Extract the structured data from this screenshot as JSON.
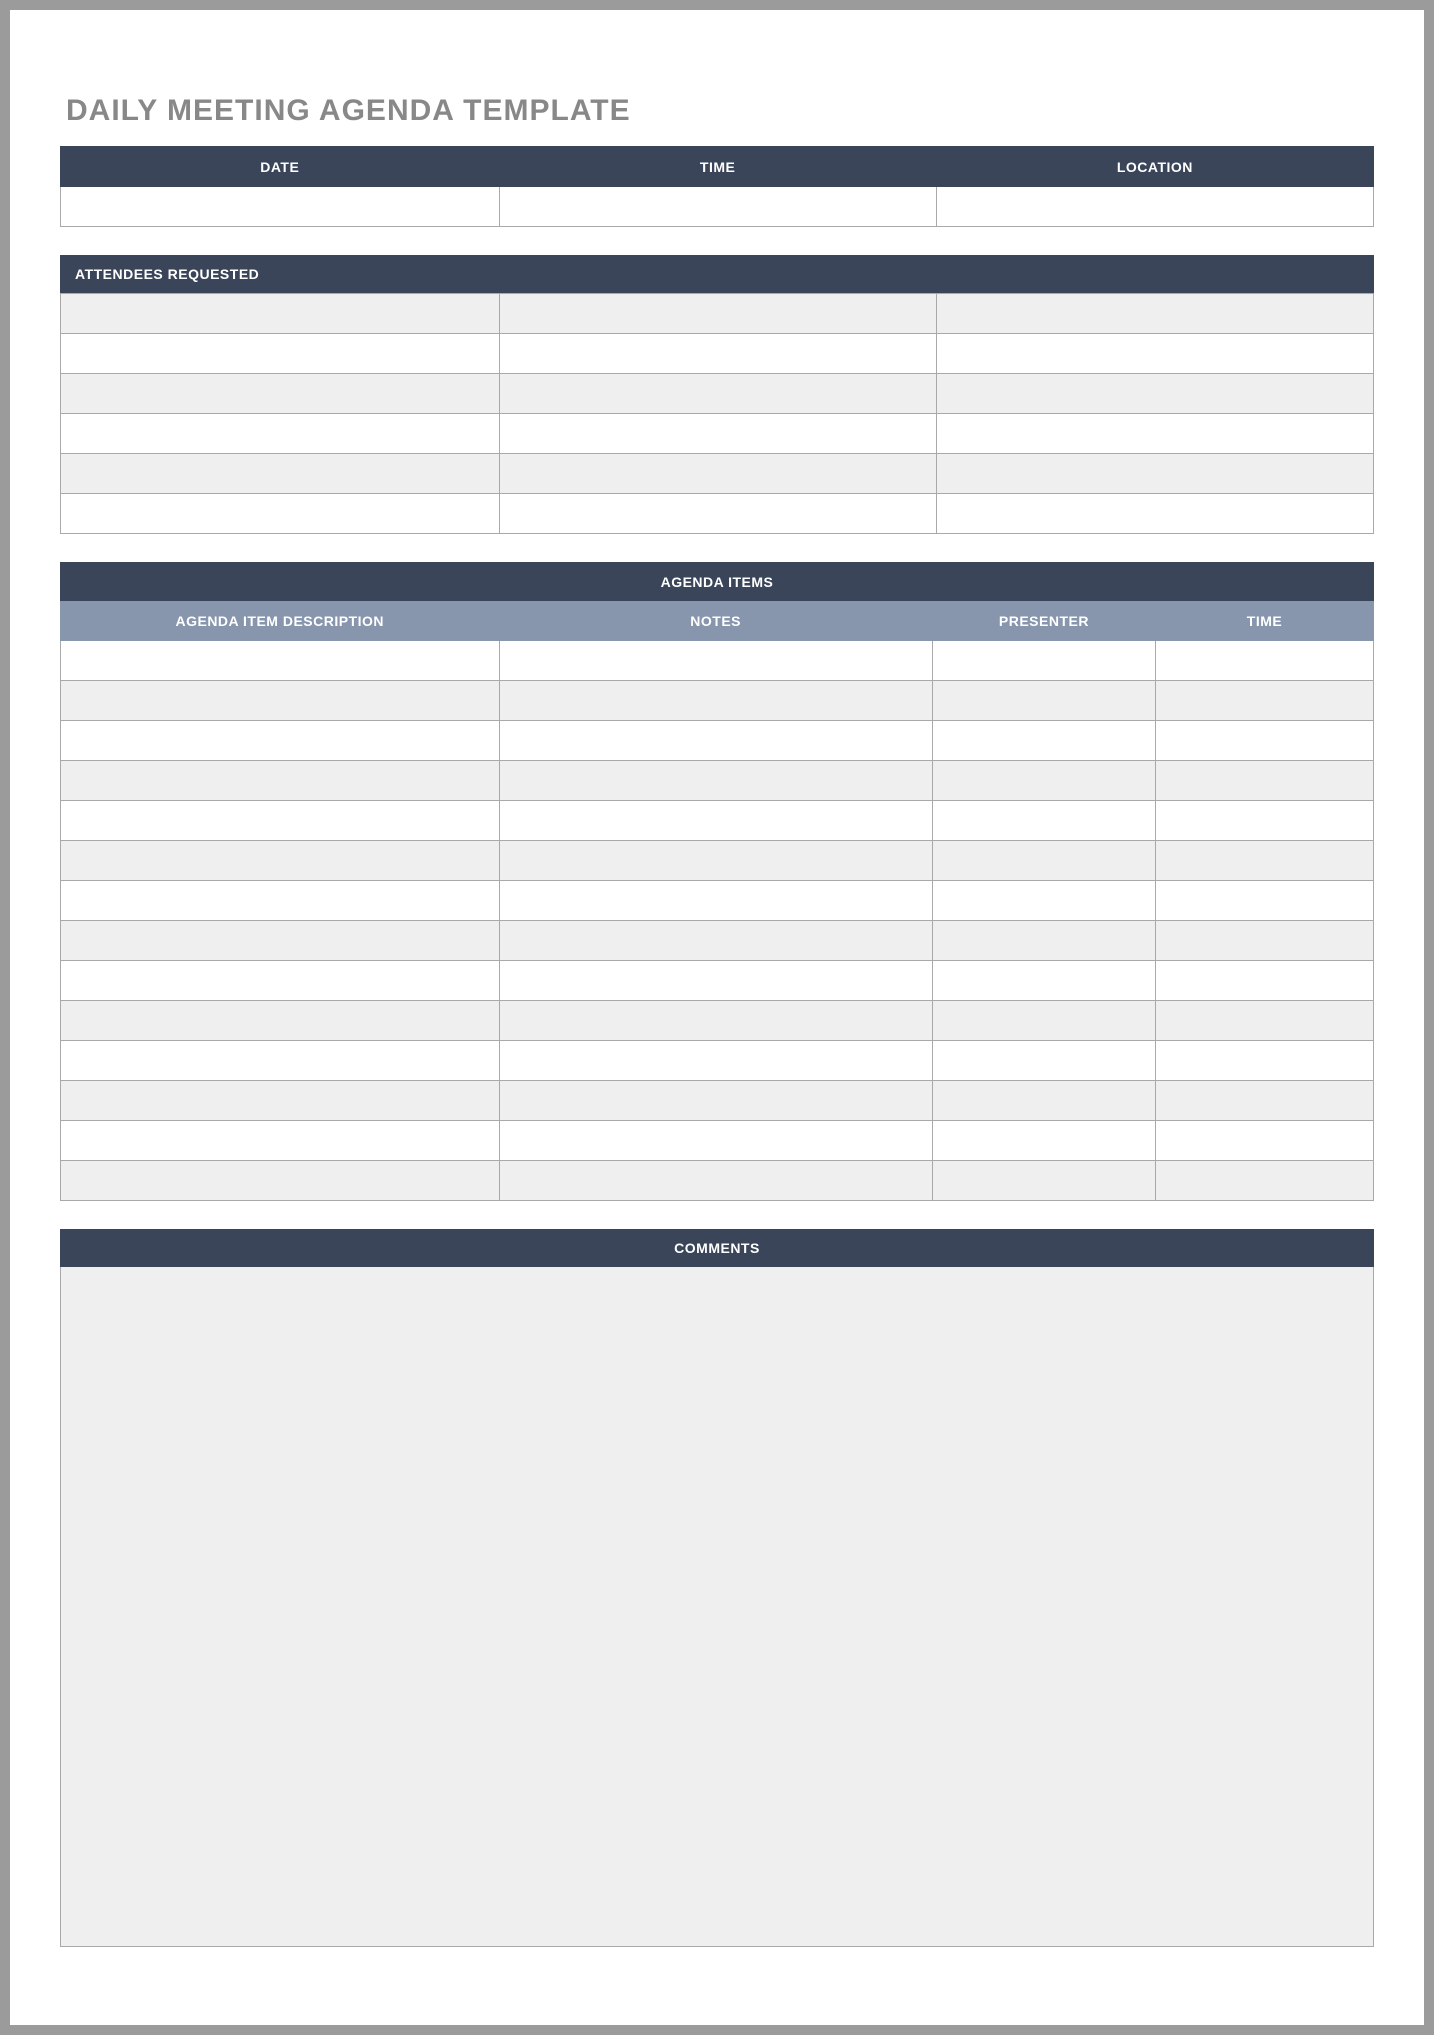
{
  "title": "DAILY MEETING AGENDA TEMPLATE",
  "details": {
    "headers": {
      "date": "DATE",
      "time": "TIME",
      "location": "LOCATION"
    },
    "values": {
      "date": "",
      "time": "",
      "location": ""
    }
  },
  "attendees": {
    "header": "ATTENDEES REQUESTED",
    "rows": [
      [
        "",
        "",
        ""
      ],
      [
        "",
        "",
        ""
      ],
      [
        "",
        "",
        ""
      ],
      [
        "",
        "",
        ""
      ],
      [
        "",
        "",
        ""
      ],
      [
        "",
        "",
        ""
      ]
    ]
  },
  "agenda": {
    "section_title": "AGENDA ITEMS",
    "columns": {
      "description": "AGENDA ITEM DESCRIPTION",
      "notes": "NOTES",
      "presenter": "PRESENTER",
      "time": "TIME"
    },
    "rows": [
      [
        "",
        "",
        "",
        ""
      ],
      [
        "",
        "",
        "",
        ""
      ],
      [
        "",
        "",
        "",
        ""
      ],
      [
        "",
        "",
        "",
        ""
      ],
      [
        "",
        "",
        "",
        ""
      ],
      [
        "",
        "",
        "",
        ""
      ],
      [
        "",
        "",
        "",
        ""
      ],
      [
        "",
        "",
        "",
        ""
      ],
      [
        "",
        "",
        "",
        ""
      ],
      [
        "",
        "",
        "",
        ""
      ],
      [
        "",
        "",
        "",
        ""
      ],
      [
        "",
        "",
        "",
        ""
      ],
      [
        "",
        "",
        "",
        ""
      ],
      [
        "",
        "",
        "",
        ""
      ]
    ]
  },
  "comments": {
    "header": "COMMENTS",
    "body": ""
  }
}
